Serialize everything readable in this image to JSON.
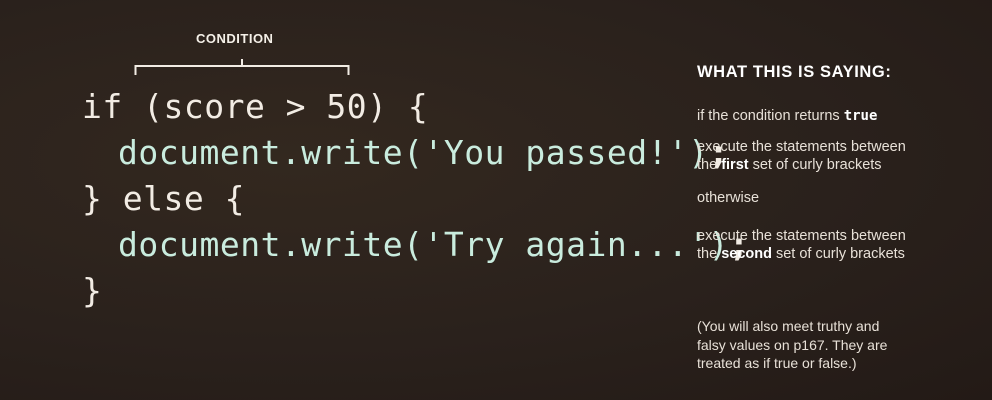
{
  "condition_label": "CONDITION",
  "code": {
    "line1": "if (score > 50) {",
    "line2": "document.write('You passed!')",
    "line2_semi": ";",
    "line3": "} else {",
    "line4": "document.write('Try again...')",
    "line4_semi": ";",
    "line5": "}"
  },
  "explanation": {
    "heading": "WHAT THIS IS SAYING:",
    "item1_text": "if the condition returns ",
    "item1_code": "true",
    "item2_line1": "execute the statements between",
    "item2_line2_pre": "the ",
    "item2_line2_bold": "first",
    "item2_line2_post": " set of curly brackets",
    "item3": "otherwise",
    "item4_line1": "execute the statements between",
    "item4_line2_pre": "the ",
    "item4_line2_bold": "second",
    "item4_line2_post": " set of curly brackets"
  },
  "note": {
    "line1": "(You will also meet truthy and",
    "line2": "falsy values on p167. They are",
    "line3": "treated as if true or false.)"
  },
  "colors": {
    "background": "#2a201c",
    "code_text": "#f2ece4",
    "code_highlight": "#c9ecde"
  }
}
